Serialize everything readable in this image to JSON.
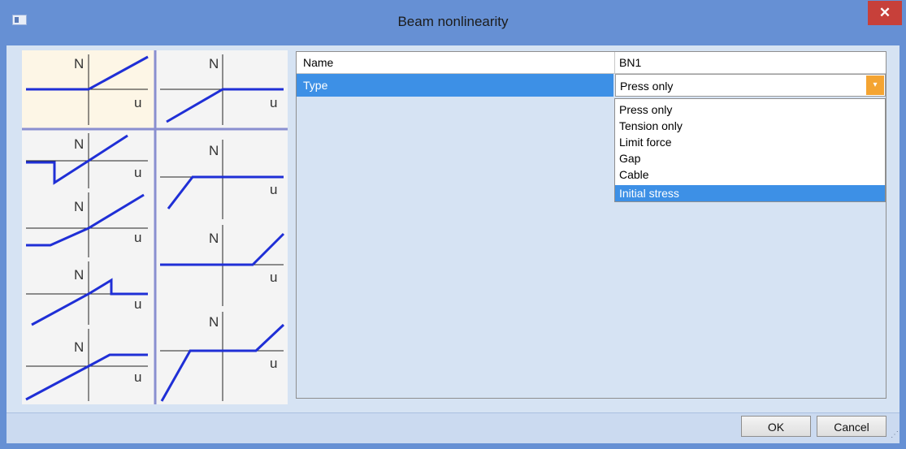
{
  "window": {
    "title": "Beam nonlinearity",
    "close_glyph": "✕"
  },
  "properties": {
    "name": {
      "label": "Name",
      "value": "BN1"
    },
    "type": {
      "label": "Type",
      "value": "Press only",
      "dropdown_glyph": "▾"
    }
  },
  "dropdown": {
    "options": [
      "Press only",
      "Tension only",
      "Limit force",
      "Gap",
      "Cable",
      "Initial stress"
    ],
    "highlighted": "Initial stress"
  },
  "diagrams": {
    "axis_n": "N",
    "axis_u": "u"
  },
  "buttons": {
    "ok": "OK",
    "cancel": "Cancel"
  },
  "colors": {
    "titlebar": "#6690d4",
    "selection": "#3d90e6",
    "curve": "#1f2fd6",
    "dropdown_button": "#f4a432"
  }
}
